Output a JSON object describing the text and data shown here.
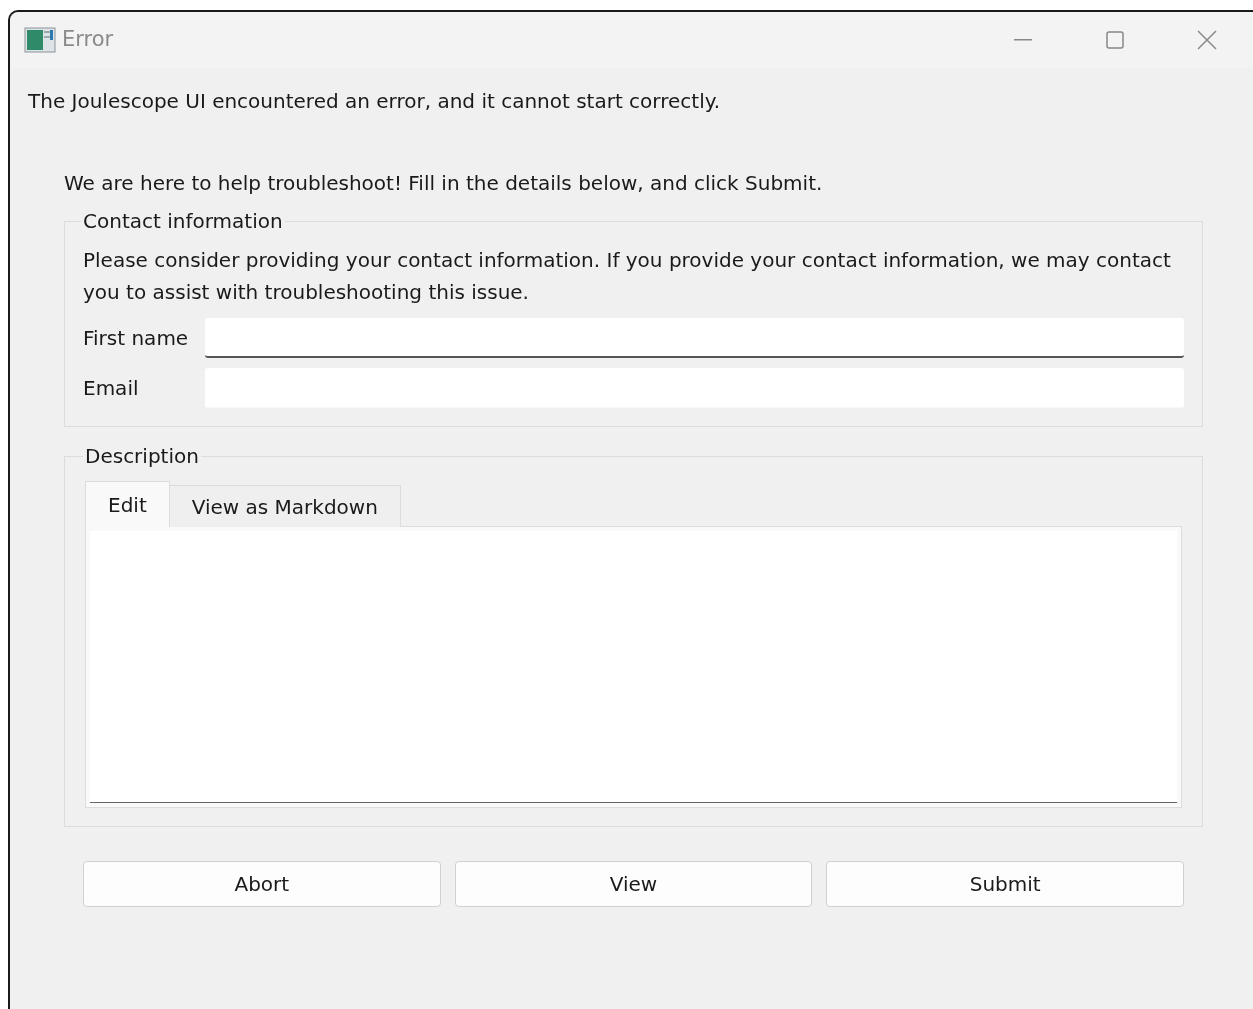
{
  "window": {
    "title": "Error"
  },
  "message": "The Joulescope UI encountered an error, and it cannot start correctly.",
  "intro": "We are here to help troubleshoot! Fill in the details below, and click Submit.",
  "contact": {
    "title": "Contact information",
    "text": "Please consider providing your contact information. If you provide your contact information, we may contact you to assist with troubleshooting this issue.",
    "fields": [
      {
        "label": "First name",
        "focused": true
      },
      {
        "label": "Email",
        "focused": false
      }
    ]
  },
  "description": {
    "title": "Description",
    "tabs": [
      {
        "label": "Edit",
        "selected": true
      },
      {
        "label": "View as Markdown",
        "selected": false
      }
    ]
  },
  "buttons": [
    "Abort",
    "View",
    "Submit"
  ]
}
